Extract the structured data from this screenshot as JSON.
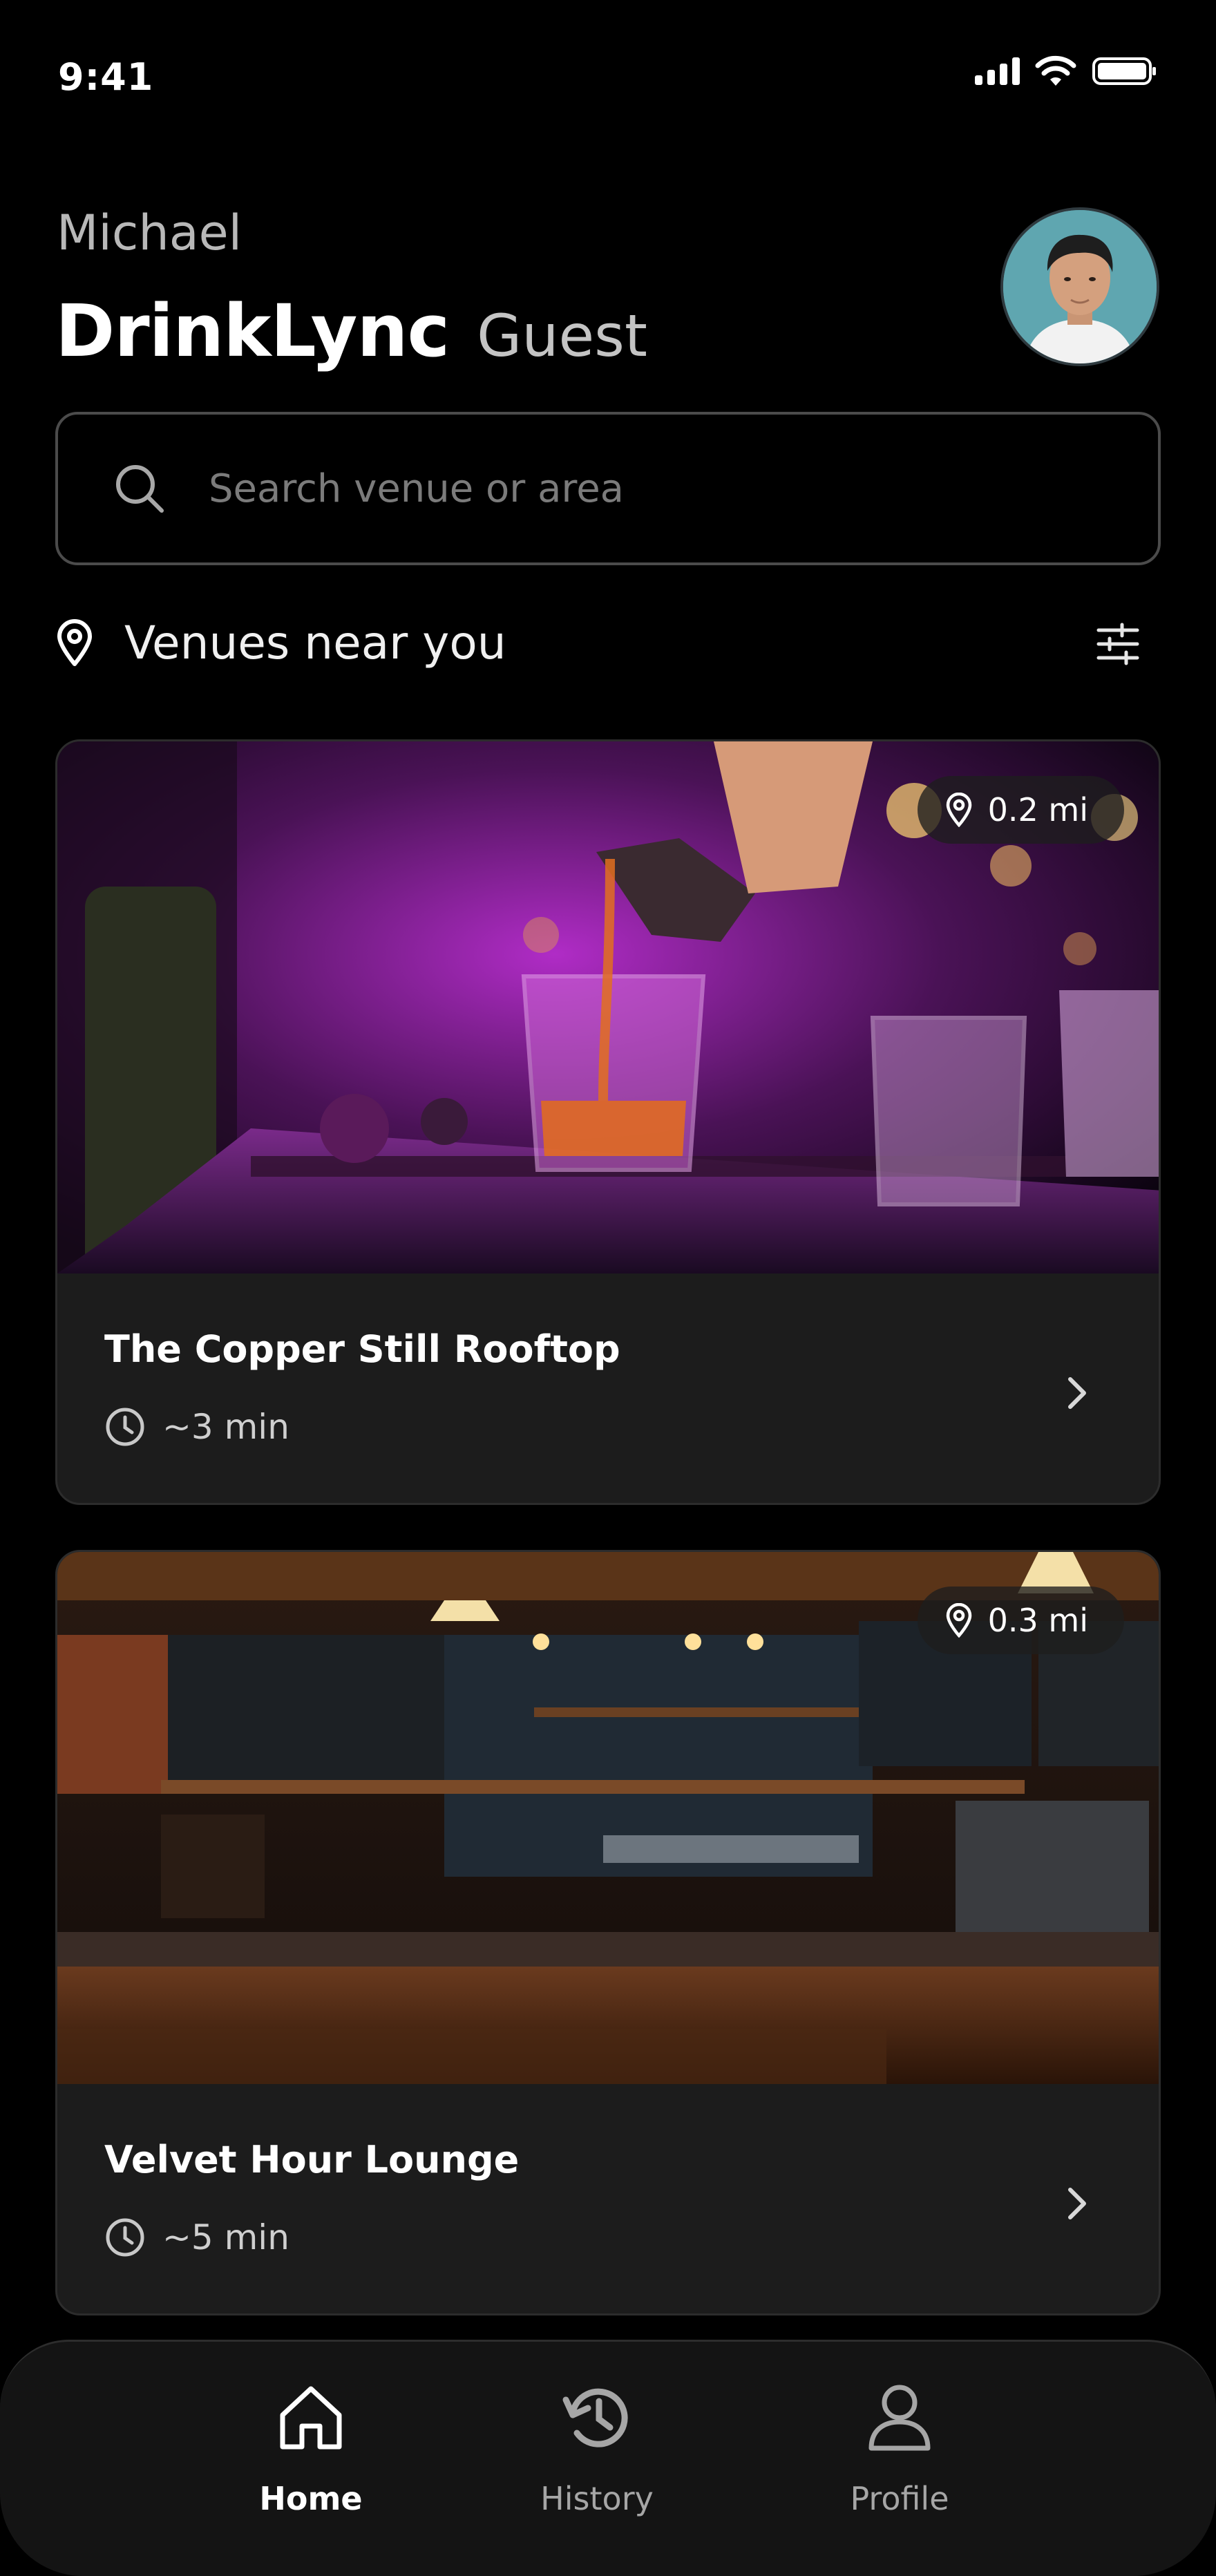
{
  "status_bar": {
    "time": "9:41"
  },
  "header": {
    "user_name": "Michael",
    "app_name": "DrinkLync",
    "role": "Guest"
  },
  "search": {
    "placeholder": "Search venue or area"
  },
  "section": {
    "title": "Venues near you"
  },
  "venues": [
    {
      "name": "The Copper Still Rooftop",
      "distance": "0.2 mi",
      "eta": "~3 min"
    },
    {
      "name": "Velvet Hour Lounge",
      "distance": "0.3 mi",
      "eta": "~5 min"
    }
  ],
  "nav": {
    "items": [
      {
        "label": "Home",
        "icon": "home-icon",
        "active": true
      },
      {
        "label": "History",
        "icon": "history-icon",
        "active": false
      },
      {
        "label": "Profile",
        "icon": "profile-icon",
        "active": false
      }
    ]
  },
  "colors": {
    "background": "#000000",
    "card": "#1c1c1c",
    "muted_text": "#b8b8b8",
    "nav_bar": "#141414",
    "accent_magenta": "#c03cd8",
    "accent_amber": "#e0a040"
  }
}
